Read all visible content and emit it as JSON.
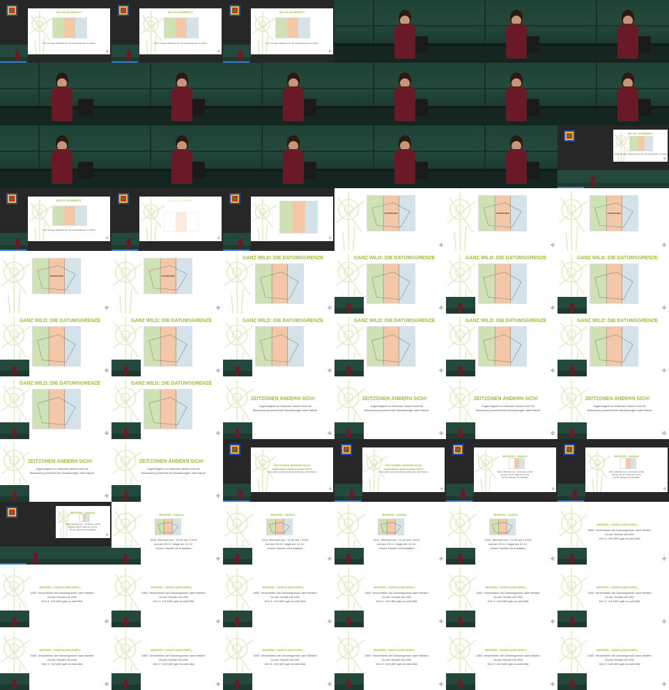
{
  "slide_titles": {
    "wo_schmerz": "WO ES SCHMERZT",
    "datumsgrenze": "GANZ WILD: DIE DATUMSGRENZE",
    "zeitzonen": "ZEITZONEN ÄNDERN SICH!",
    "samoa": "BEISPIEL: SAMOA",
    "samoa_hawaii": "BEISPIEL: SAMOA (WECHSEL)"
  },
  "slide_lines": {
    "wo_caption": "Kurz vorangs' Offsetzeit der 15-und 45-Minuten zu finden",
    "zeitzonen": [
      "Zugehörigkeit zu Zeitzonen ändert nicht fix",
      "Besonders prominent bei Auswirkungen aufs Datum"
    ],
    "samoa": [
      "2011: Wechsel von −11:00 auf +13:00",
      "Auf den 29.12. folgte der 31.12.",
      "Grund: Handel mit Australien"
    ],
    "samoa_hawaii": [
      "1892: Verschieben der Datumsgrenze nach Westen",
      "Grund: Handel mit USA",
      "Den 4. Juli 1892 gab es zwei Mal"
    ]
  },
  "map_label": "AUSTRALIEN",
  "nav_symbol": "✣",
  "colors": {
    "accent": "#9ac238",
    "slide_background": "#ffffff",
    "hall_board": "#23493c",
    "shirt": "#6a1a26",
    "window_background": "#272727",
    "progress": "#2f7fd3"
  },
  "tiles": [
    {
      "kind": "win",
      "slide": "wo",
      "cam": true
    },
    {
      "kind": "win",
      "slide": "wo",
      "cam": true
    },
    {
      "kind": "win",
      "slide": "wo",
      "cam": true
    },
    {
      "kind": "cam",
      "person": "right"
    },
    {
      "kind": "cam",
      "person": "right"
    },
    {
      "kind": "cam",
      "person": "right"
    },
    {
      "kind": "cam",
      "person": "left"
    },
    {
      "kind": "cam",
      "person": "right"
    },
    {
      "kind": "cam",
      "person": "right"
    },
    {
      "kind": "cam",
      "person": "right"
    },
    {
      "kind": "cam",
      "person": "right"
    },
    {
      "kind": "cam",
      "person": "right"
    },
    {
      "kind": "cam",
      "person": "left"
    },
    {
      "kind": "cam",
      "person": "right"
    },
    {
      "kind": "cam",
      "person": "right"
    },
    {
      "kind": "cam",
      "person": "right"
    },
    {
      "kind": "cam",
      "person": "right"
    },
    {
      "kind": "win",
      "slide": "wo",
      "cam": true,
      "small": true
    },
    {
      "kind": "win",
      "slide": "wo",
      "cam": true,
      "wide": true
    },
    {
      "kind": "win",
      "slide": "faint",
      "cam": true,
      "wide": true
    },
    {
      "kind": "win",
      "slide": "austr",
      "cam": true,
      "wide": true
    },
    {
      "kind": "pres",
      "slide": "austr"
    },
    {
      "kind": "pres",
      "slide": "austr"
    },
    {
      "kind": "pres",
      "slide": "austr"
    },
    {
      "kind": "pres",
      "slide": "austr"
    },
    {
      "kind": "pres",
      "slide": "austr"
    },
    {
      "kind": "pres",
      "slide": "datum"
    },
    {
      "kind": "pres",
      "slide": "datum",
      "inset": true
    },
    {
      "kind": "pres",
      "slide": "datum",
      "inset": true
    },
    {
      "kind": "pres",
      "slide": "datum",
      "inset": true
    },
    {
      "kind": "pres",
      "slide": "datum",
      "inset": true
    },
    {
      "kind": "pres",
      "slide": "datum",
      "inset": true
    },
    {
      "kind": "pres",
      "slide": "datum",
      "inset": true
    },
    {
      "kind": "pres",
      "slide": "datum",
      "inset": true
    },
    {
      "kind": "pres",
      "slide": "datum",
      "inset": true
    },
    {
      "kind": "pres",
      "slide": "datum",
      "inset": true
    },
    {
      "kind": "pres",
      "slide": "datum",
      "inset": true
    },
    {
      "kind": "pres",
      "slide": "datum",
      "inset": true
    },
    {
      "kind": "pres",
      "slide": "zeit",
      "inset": true
    },
    {
      "kind": "pres",
      "slide": "zeit",
      "inset": true
    },
    {
      "kind": "pres",
      "slide": "zeit",
      "inset": true
    },
    {
      "kind": "pres",
      "slide": "zeit",
      "inset": true
    },
    {
      "kind": "pres",
      "slide": "zeit",
      "inset": true
    },
    {
      "kind": "pres",
      "slide": "zeit",
      "inset": true
    },
    {
      "kind": "win",
      "slide": "zeit",
      "cam": true,
      "wide": true
    },
    {
      "kind": "win",
      "slide": "zeit",
      "cam": true,
      "wide": true
    },
    {
      "kind": "win",
      "slide": "samoa",
      "cam": true,
      "wide": true
    },
    {
      "kind": "win",
      "slide": "samoa",
      "cam": true,
      "wide": true
    },
    {
      "kind": "win",
      "slide": "samoa",
      "cam": true,
      "small": true
    },
    {
      "kind": "pres",
      "slide": "samoa",
      "inset": true
    },
    {
      "kind": "pres",
      "slide": "samoa",
      "inset": true
    },
    {
      "kind": "pres",
      "slide": "samoa",
      "inset": true
    },
    {
      "kind": "pres",
      "slide": "samoa",
      "inset": true
    },
    {
      "kind": "pres",
      "slide": "hawaii",
      "inset": true
    },
    {
      "kind": "pres",
      "slide": "hawaii",
      "inset": true
    },
    {
      "kind": "pres",
      "slide": "hawaii",
      "inset": true
    },
    {
      "kind": "pres",
      "slide": "hawaii",
      "inset": true
    },
    {
      "kind": "pres",
      "slide": "hawaii",
      "inset": true
    },
    {
      "kind": "pres",
      "slide": "hawaii",
      "inset": true
    },
    {
      "kind": "pres",
      "slide": "hawaii",
      "inset": true
    },
    {
      "kind": "pres",
      "slide": "hawaii",
      "inset": true
    },
    {
      "kind": "pres",
      "slide": "hawaii",
      "inset": true
    },
    {
      "kind": "pres",
      "slide": "hawaii",
      "inset": true
    },
    {
      "kind": "pres",
      "slide": "hawaii",
      "inset": true
    },
    {
      "kind": "pres",
      "slide": "hawaii",
      "inset": true
    },
    {
      "kind": "pres",
      "slide": "hawaii",
      "inset": true
    }
  ]
}
